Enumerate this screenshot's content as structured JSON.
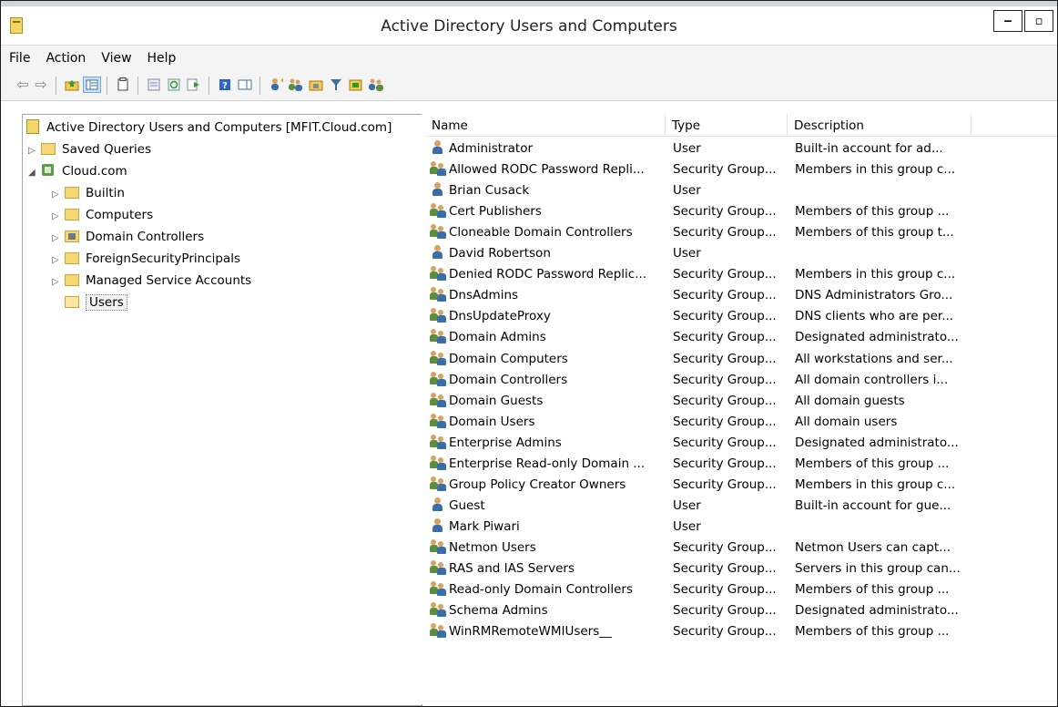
{
  "window": {
    "title": "Active Directory Users and Computers",
    "minimize_glyph": "‒",
    "restore_glyph": "▫"
  },
  "menu": [
    {
      "label": "File"
    },
    {
      "label": "Action"
    },
    {
      "label": "View"
    },
    {
      "label": "Help"
    }
  ],
  "toolbar_icons": [
    "back-arrow-icon",
    "forward-arrow-icon",
    "up-folder-icon",
    "show-console-tree-icon",
    "copy-icon",
    "properties-icon",
    "refresh-icon",
    "export-list-icon",
    "help-icon",
    "action-pane-icon",
    "new-user-icon",
    "new-group-icon",
    "new-ou-icon",
    "filter-icon",
    "find-icon",
    "add-to-group-icon"
  ],
  "tree": {
    "root": "Active Directory Users and Computers [MFIT.Cloud.com]",
    "saved_queries": "Saved Queries",
    "domain": "Cloud.com",
    "children": [
      {
        "label": "Builtin"
      },
      {
        "label": "Computers"
      },
      {
        "label": "Domain Controllers"
      },
      {
        "label": "ForeignSecurityPrincipals"
      },
      {
        "label": "Managed Service Accounts"
      },
      {
        "label": "Users"
      }
    ]
  },
  "columns": {
    "name": "Name",
    "type": "Type",
    "description": "Description"
  },
  "rows": [
    {
      "name": "Administrator",
      "type": "User",
      "desc": "Built-in account for ad...",
      "icon": "user"
    },
    {
      "name": "Allowed RODC Password Repli...",
      "type": "Security Group...",
      "desc": "Members in this group c...",
      "icon": "group"
    },
    {
      "name": "Brian Cusack",
      "type": "User",
      "desc": "",
      "icon": "user"
    },
    {
      "name": "Cert Publishers",
      "type": "Security Group...",
      "desc": "Members of this group ...",
      "icon": "group"
    },
    {
      "name": "Cloneable Domain Controllers",
      "type": "Security Group...",
      "desc": "Members of this group t...",
      "icon": "group"
    },
    {
      "name": "David Robertson",
      "type": "User",
      "desc": "",
      "icon": "user"
    },
    {
      "name": "Denied RODC Password Replic...",
      "type": "Security Group...",
      "desc": "Members in this group c...",
      "icon": "group"
    },
    {
      "name": "DnsAdmins",
      "type": "Security Group...",
      "desc": "DNS Administrators Gro...",
      "icon": "group"
    },
    {
      "name": "DnsUpdateProxy",
      "type": "Security Group...",
      "desc": "DNS clients who are per...",
      "icon": "group"
    },
    {
      "name": "Domain Admins",
      "type": "Security Group...",
      "desc": "Designated administrato...",
      "icon": "group"
    },
    {
      "name": "Domain Computers",
      "type": "Security Group...",
      "desc": "All workstations and ser...",
      "icon": "group"
    },
    {
      "name": "Domain Controllers",
      "type": "Security Group...",
      "desc": "All domain controllers i...",
      "icon": "group"
    },
    {
      "name": "Domain Guests",
      "type": "Security Group...",
      "desc": "All domain guests",
      "icon": "group"
    },
    {
      "name": "Domain Users",
      "type": "Security Group...",
      "desc": "All domain users",
      "icon": "group"
    },
    {
      "name": "Enterprise Admins",
      "type": "Security Group...",
      "desc": "Designated administrato...",
      "icon": "group"
    },
    {
      "name": "Enterprise Read-only Domain ...",
      "type": "Security Group...",
      "desc": "Members of this group ...",
      "icon": "group"
    },
    {
      "name": "Group Policy Creator Owners",
      "type": "Security Group...",
      "desc": "Members in this group c...",
      "icon": "group"
    },
    {
      "name": "Guest",
      "type": "User",
      "desc": "Built-in account for gue...",
      "icon": "user"
    },
    {
      "name": "Mark Piwari",
      "type": "User",
      "desc": "",
      "icon": "user"
    },
    {
      "name": "Netmon Users",
      "type": "Security Group...",
      "desc": "Netmon Users can capt...",
      "icon": "group"
    },
    {
      "name": "RAS and IAS Servers",
      "type": "Security Group...",
      "desc": "Servers in this group can...",
      "icon": "group"
    },
    {
      "name": "Read-only Domain Controllers",
      "type": "Security Group...",
      "desc": "Members of this group ...",
      "icon": "group"
    },
    {
      "name": "Schema Admins",
      "type": "Security Group...",
      "desc": "Designated administrato...",
      "icon": "group"
    },
    {
      "name": "WinRMRemoteWMIUsers__",
      "type": "Security Group...",
      "desc": "Members of this group ...",
      "icon": "group"
    }
  ]
}
